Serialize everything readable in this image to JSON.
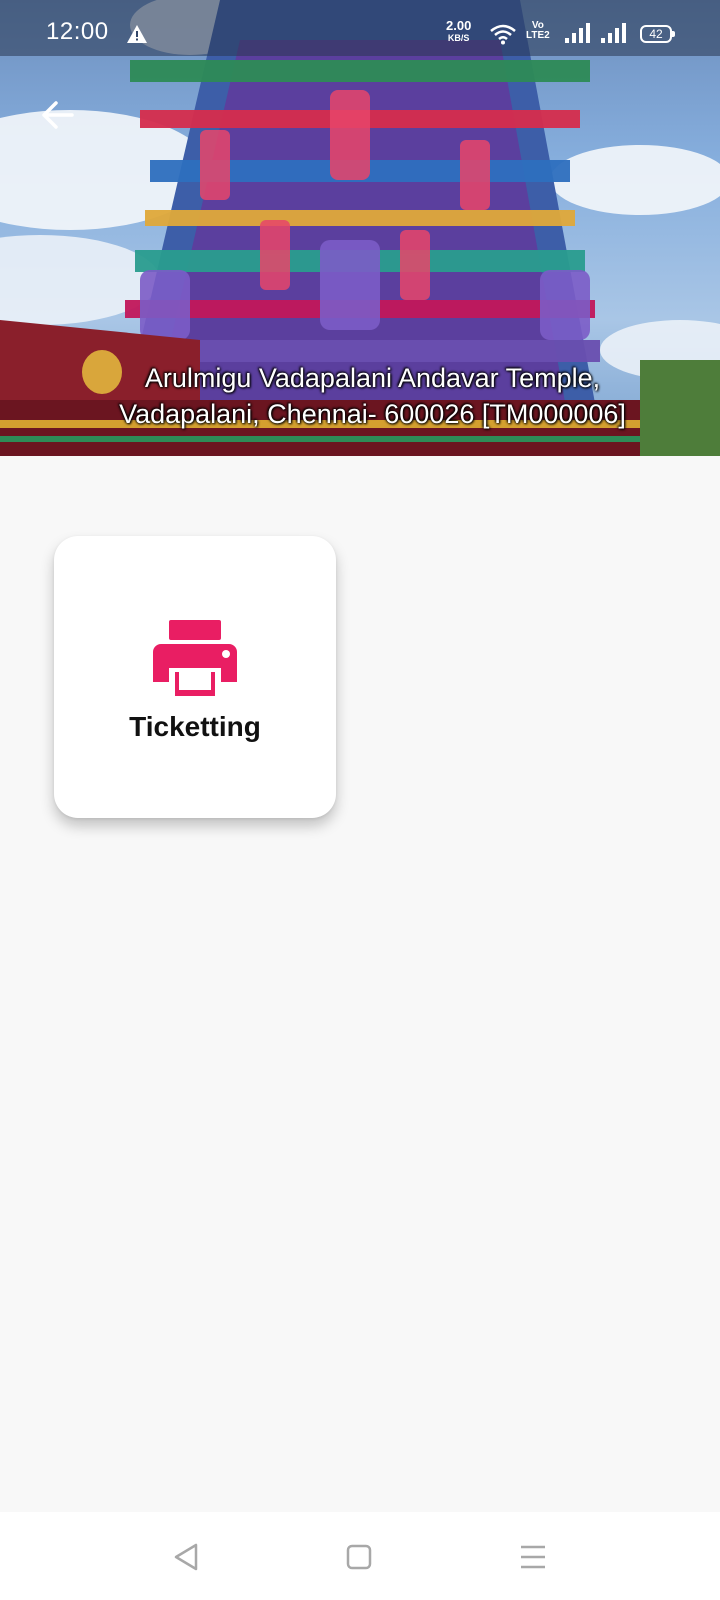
{
  "status_bar": {
    "time": "12:00",
    "speed_value": "2.00",
    "speed_unit": "KB/S",
    "volte_top": "Vo",
    "volte_bottom": "LTE2",
    "battery": "42"
  },
  "header": {
    "title_line1": "Arulmigu Vadapalani Andavar Temple,",
    "title_line2": "Vadapalani, Chennai- 600026 [TM000006]"
  },
  "menu": {
    "items": [
      {
        "label": "Ticketting",
        "icon": "printer-icon",
        "color": "#e91e63"
      }
    ]
  },
  "nav": {
    "back": "back-triangle-icon",
    "home": "home-square-icon",
    "recents": "menu-lines-icon"
  },
  "colors": {
    "accent": "#e91e63",
    "background": "#f8f8f8"
  }
}
